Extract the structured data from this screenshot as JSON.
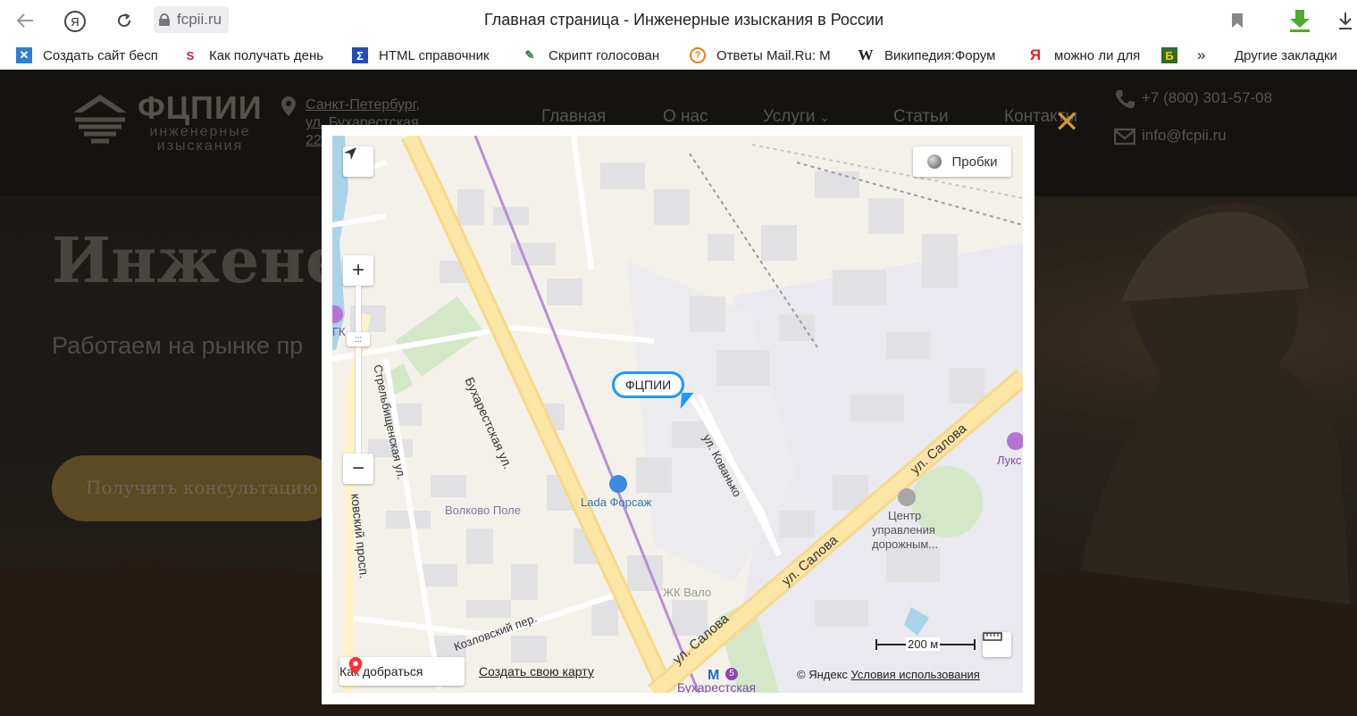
{
  "browser": {
    "url": "fcpii.ru",
    "tab_title": "Главная страница - Инженерные изыскания в России",
    "yandex_button": "Я",
    "bookmarks": [
      {
        "icon": "constructor-icon",
        "label": "Создать сайт бесп"
      },
      {
        "icon": "superman-icon",
        "label": "Как получать день"
      },
      {
        "icon": "html-ref-icon",
        "label": "HTML справочник"
      },
      {
        "icon": "script-icon",
        "label": "Скрипт голосован"
      },
      {
        "icon": "mail-answers-icon",
        "label": "Ответы Mail.Ru: М"
      },
      {
        "icon": "wikipedia-icon",
        "label": "Википедия:Форум"
      },
      {
        "icon": "yandex-icon",
        "label": "можно ли для"
      },
      {
        "icon": "b-icon",
        "label": ""
      },
      {
        "icon": "chevron-double-icon",
        "label": "»"
      },
      {
        "icon": "",
        "label": "Другие закладки"
      }
    ]
  },
  "site": {
    "logo_name": "ФЦПИИ",
    "logo_sub": "инженерные изыскания",
    "address": "Санкт-Петербург, ул. Бухарестская, 22",
    "nav": [
      "Главная",
      "О нас",
      "Услуги",
      "Статьи",
      "Контакты"
    ],
    "phone": "+7 (800) 301-57-08",
    "email": "info@fcpii.ru",
    "hero_title": "Инженер",
    "hero_subtitle": "Работаем на рынке пр",
    "cta": "Получить консультацию"
  },
  "map": {
    "traffic_button": "Пробки",
    "pin_label": "ФЦПИИ",
    "route_button": "Как добраться",
    "create_map": "Создать свою карту",
    "copyright_brand": "© Яндекс",
    "terms_link": "Условия использования",
    "scale_label": "200 м",
    "labels": {
      "buharestskaya": "Бухарестская ул.",
      "strelbishenskaya": "Стрельбищенская ул.",
      "volkovo": "Волково Поле",
      "lada": "Lada Форсаж",
      "kovanko": "ул. Кованько",
      "salova1": "ул. Салова",
      "salova2": "ул. Салова",
      "salova3": "ул. Салова",
      "kozlovsky": "Козловский пер.",
      "prosp": "ковский просп.",
      "center1": "Центр",
      "center2": "управления",
      "center3": "дорожным...",
      "luks": "Лукс",
      "gk": "ГК",
      "zhk": "ЖК Вало",
      "metro": "Бухарестская",
      "metro_line": "5"
    }
  }
}
